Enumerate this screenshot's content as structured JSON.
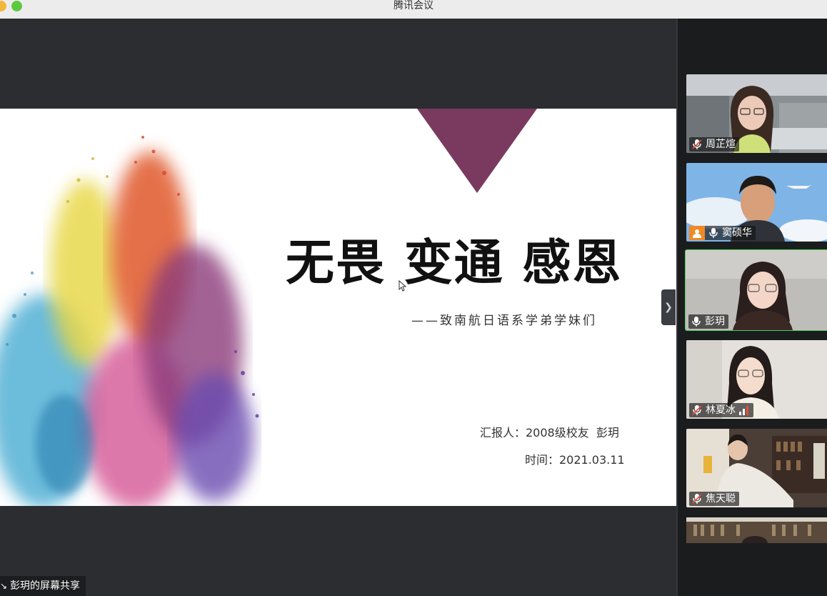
{
  "window": {
    "title": "腾讯会议"
  },
  "slide": {
    "headline": "无畏 变通 感恩",
    "subtitle": "——致南航日语系学弟学妹们",
    "reporter": "汇报人：2008级校友  彭玥",
    "date": "时间：2021.03.11"
  },
  "share_badge": {
    "label": "彭玥的屏幕共享"
  },
  "participants": [
    {
      "name": "周芷煊",
      "mic": "muted",
      "active": false
    },
    {
      "name": "窦硕华",
      "mic": "on",
      "active": false,
      "host_icon": true
    },
    {
      "name": "彭玥",
      "mic": "on",
      "active": true
    },
    {
      "name": "林夏冰",
      "mic": "muted",
      "active": false,
      "signal_icon": true
    },
    {
      "name": "焦天聪",
      "mic": "muted",
      "active": false
    }
  ],
  "colors": {
    "active_border": "#4bd35a",
    "triangle": "#7a3a5f",
    "host_badge": "#f08a24"
  },
  "icons": {
    "collapse": "chevron-right-icon",
    "cursor": "mouse-pointer-icon"
  }
}
